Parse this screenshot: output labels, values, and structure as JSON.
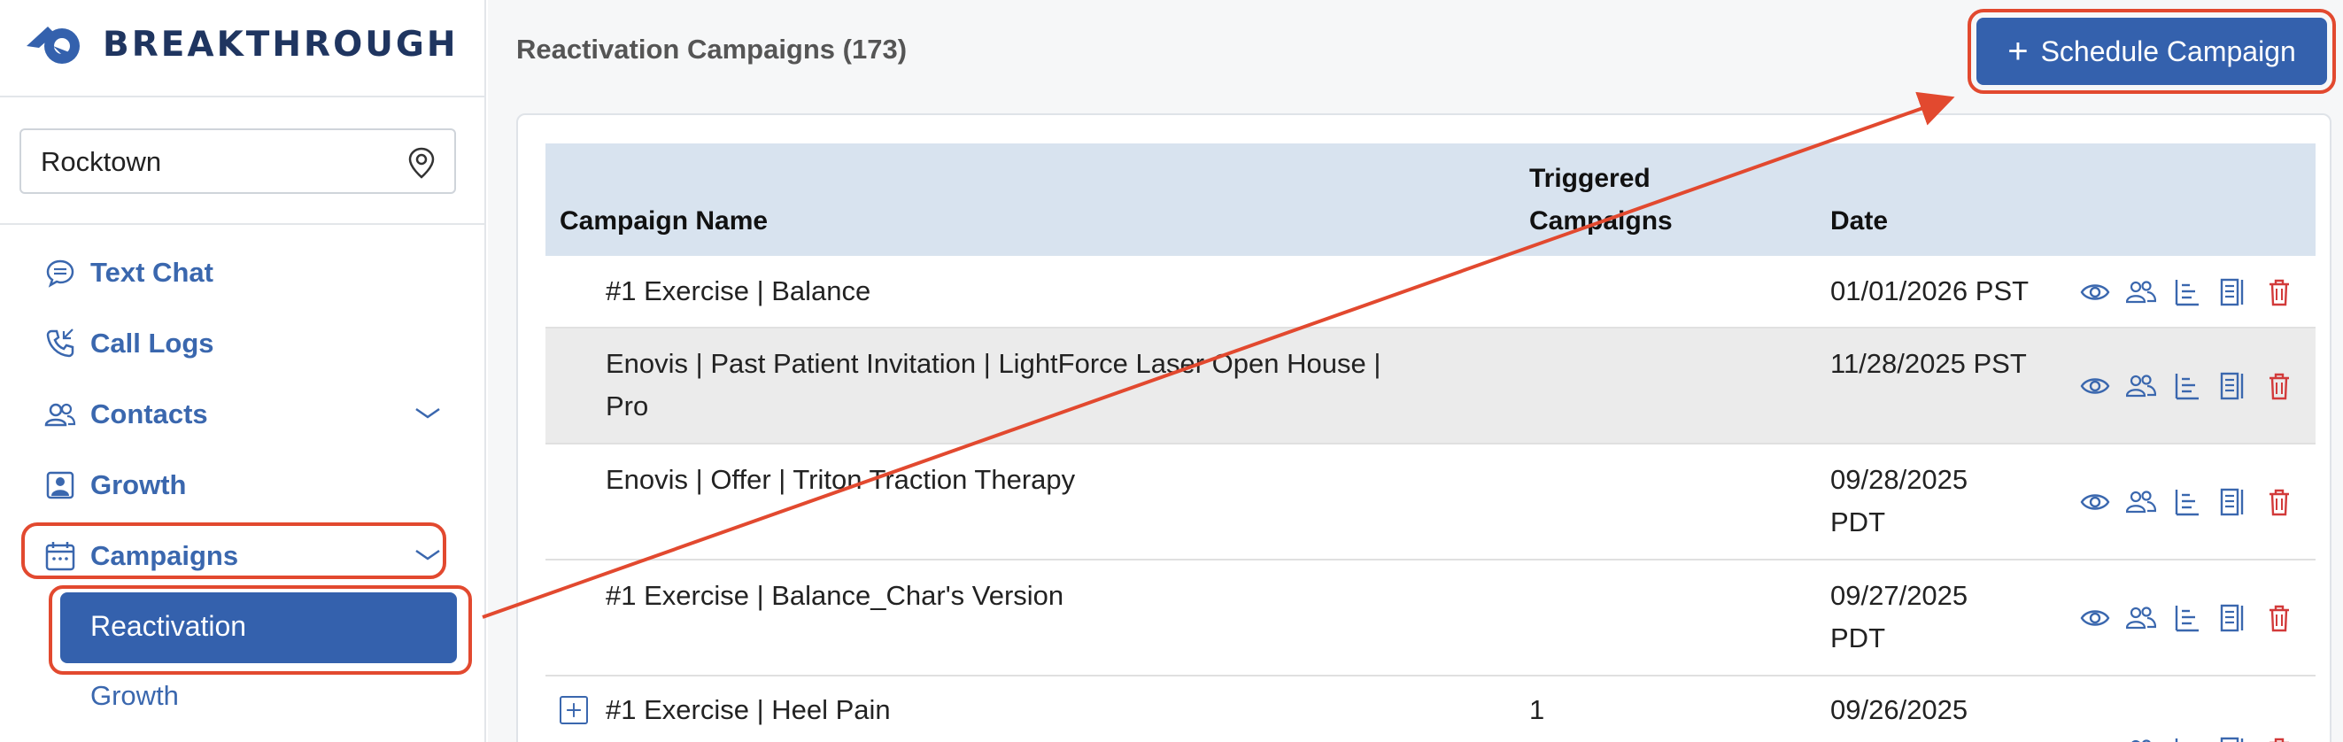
{
  "brand": {
    "name": "BREAKTHROUGH"
  },
  "location": {
    "value": "Rocktown"
  },
  "nav": {
    "text_chat": "Text Chat",
    "call_logs": "Call Logs",
    "contacts": "Contacts",
    "growth": "Growth",
    "campaigns": "Campaigns",
    "sub_reactivation": "Reactivation",
    "sub_growth": "Growth"
  },
  "header": {
    "title": "Reactivation Campaigns (173)",
    "schedule_button": "Schedule Campaign"
  },
  "table": {
    "col_name": "Campaign Name",
    "col_triggered_line1": "Triggered",
    "col_triggered_line2": "Campaigns",
    "col_date": "Date",
    "rows": [
      {
        "name": "#1 Exercise | Balance",
        "triggered": "",
        "date": "01/01/2026 PST"
      },
      {
        "name_line1": "Enovis | Past Patient Invitation | LightForce Laser Open House |",
        "name_line2": "Pro",
        "triggered": "",
        "date": "11/28/2025 PST"
      },
      {
        "name": "Enovis | Offer | Triton Traction Therapy",
        "triggered": "",
        "date_line1": "09/28/2025",
        "date_line2": "PDT"
      },
      {
        "name": "#1 Exercise | Balance_Char's Version",
        "triggered": "",
        "date_line1": "09/27/2025",
        "date_line2": "PDT"
      },
      {
        "name": "#1 Exercise | Heel Pain",
        "triggered": "1",
        "date_line1": "09/26/2025"
      }
    ]
  },
  "colors": {
    "accent": "#3461ad",
    "annotation": "#e2492f",
    "delete": "#d23a3a",
    "header_bg": "#d8e3ef"
  },
  "icons": [
    "eye-icon",
    "users-icon",
    "tree-list-icon",
    "report-icon",
    "trash-icon",
    "plus-icon",
    "map-pin-icon",
    "chat-icon",
    "phone-icon",
    "contacts-icon",
    "growth-icon",
    "calendar-icon",
    "chevron-down-icon"
  ]
}
